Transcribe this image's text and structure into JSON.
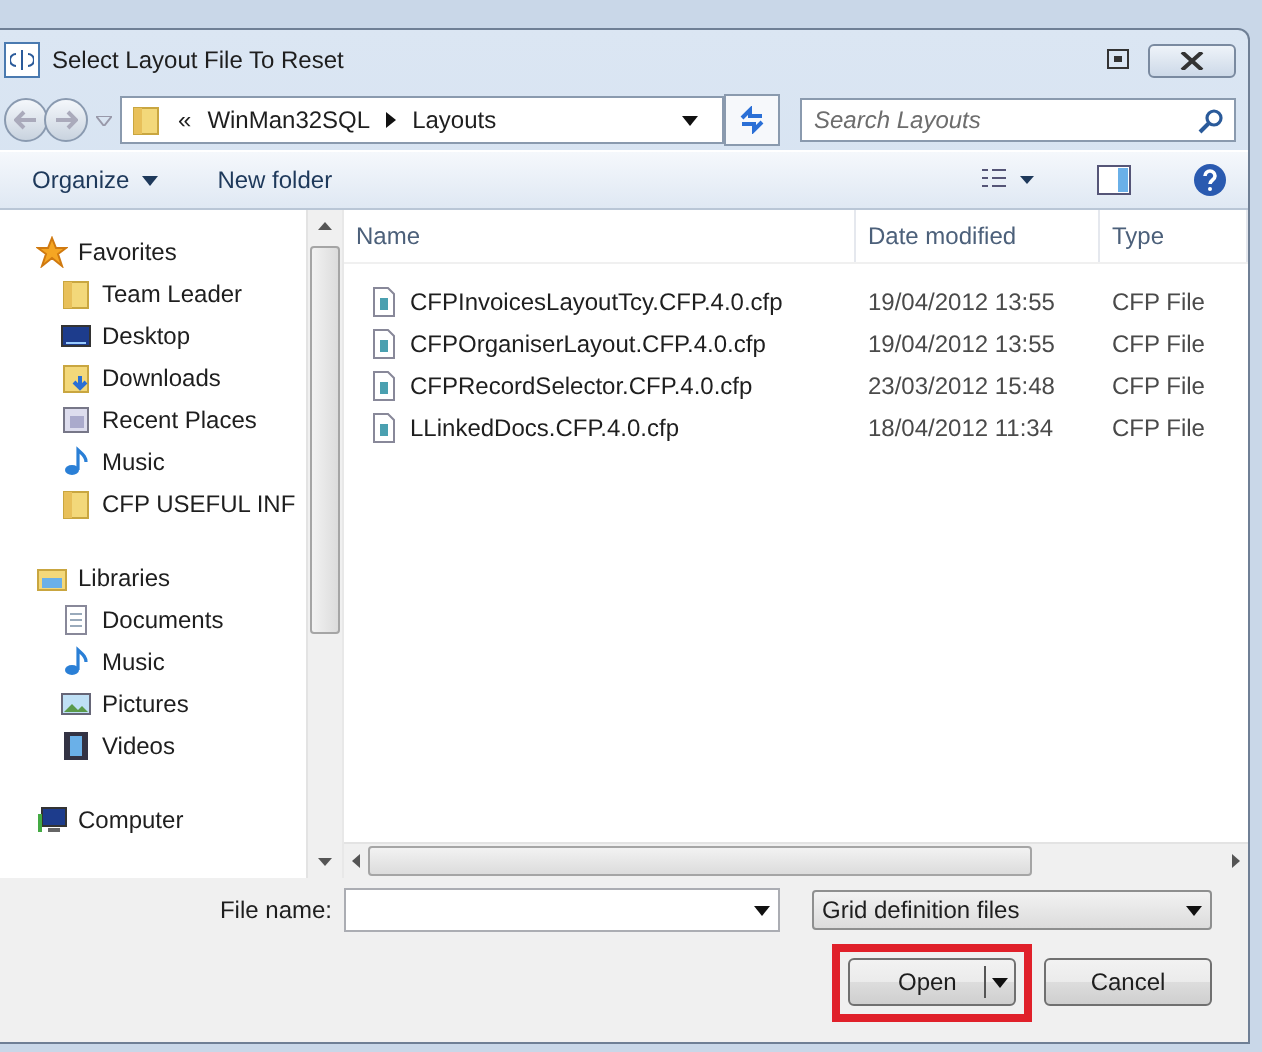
{
  "window": {
    "title": "Select Layout File To Reset"
  },
  "address": {
    "overflow": "«",
    "crumbs": [
      "WinMan32SQL",
      "Layouts"
    ]
  },
  "search": {
    "placeholder": "Search Layouts"
  },
  "toolbar": {
    "organize": "Organize",
    "new_folder": "New folder"
  },
  "sidebar": {
    "groups": [
      {
        "label": "Favorites",
        "kind": "favorites",
        "children": [
          {
            "label": "Team Leader",
            "kind": "folder"
          },
          {
            "label": "Desktop",
            "kind": "desktop"
          },
          {
            "label": "Downloads",
            "kind": "downloads"
          },
          {
            "label": "Recent Places",
            "kind": "recent"
          },
          {
            "label": "Music",
            "kind": "music"
          },
          {
            "label": "CFP USEFUL INF",
            "kind": "folder"
          }
        ]
      },
      {
        "label": "Libraries",
        "kind": "libraries",
        "children": [
          {
            "label": "Documents",
            "kind": "documents"
          },
          {
            "label": "Music",
            "kind": "music"
          },
          {
            "label": "Pictures",
            "kind": "pictures"
          },
          {
            "label": "Videos",
            "kind": "videos"
          }
        ]
      },
      {
        "label": "Computer",
        "kind": "computer"
      }
    ]
  },
  "table": {
    "columns": [
      "Name",
      "Date modified",
      "Type"
    ],
    "rows": [
      {
        "name": "CFPInvoicesLayoutTcy.CFP.4.0.cfp",
        "date": "19/04/2012 13:55",
        "type": "CFP File"
      },
      {
        "name": "CFPOrganiserLayout.CFP.4.0.cfp",
        "date": "19/04/2012 13:55",
        "type": "CFP File"
      },
      {
        "name": "CFPRecordSelector.CFP.4.0.cfp",
        "date": "23/03/2012 15:48",
        "type": "CFP File"
      },
      {
        "name": "LLinkedDocs.CFP.4.0.cfp",
        "date": "18/04/2012 11:34",
        "type": "CFP File"
      }
    ]
  },
  "footer": {
    "file_name_label": "File name:",
    "filter": "Grid definition files",
    "open": "Open",
    "cancel": "Cancel",
    "open_highlighted": true
  }
}
